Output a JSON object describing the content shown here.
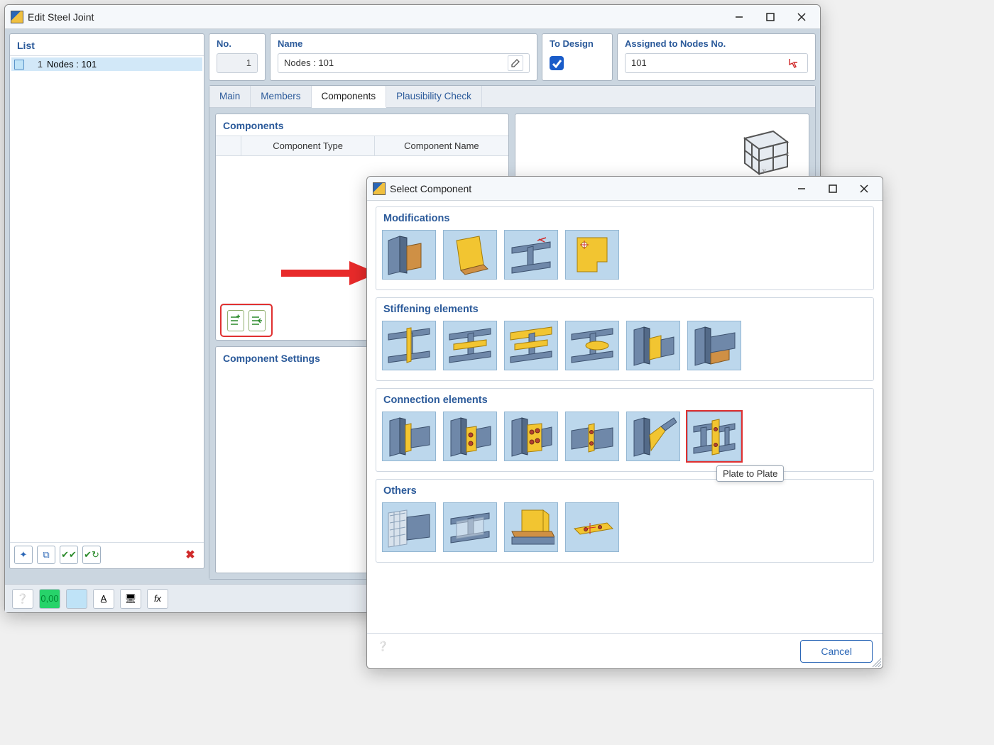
{
  "main_window": {
    "title": "Edit Steel Joint",
    "left": {
      "label": "List",
      "items": [
        {
          "index": "1",
          "text": "Nodes : 101"
        }
      ],
      "buttons": [
        "new",
        "copy",
        "check-all",
        "check-sel",
        "delete"
      ]
    },
    "fields": {
      "no_label": "No.",
      "no_value": "1",
      "name_label": "Name",
      "name_value": "Nodes : 101",
      "to_design_label": "To Design",
      "to_design_value": true,
      "assigned_label": "Assigned to Nodes No.",
      "assigned_value": "101"
    },
    "tabs": [
      "Main",
      "Members",
      "Components",
      "Plausibility Check"
    ],
    "active_tab": 2,
    "components": {
      "title": "Components",
      "col_type": "Component Type",
      "col_name": "Component Name",
      "settings_title": "Component Settings"
    }
  },
  "dialog": {
    "title": "Select Component",
    "categories": [
      {
        "title": "Modifications",
        "count": 4
      },
      {
        "title": "Stiffening elements",
        "count": 6
      },
      {
        "title": "Connection elements",
        "count": 6,
        "selected_index": 5,
        "selected_tooltip": "Plate to Plate"
      },
      {
        "title": "Others",
        "count": 4
      }
    ],
    "cancel": "Cancel"
  }
}
